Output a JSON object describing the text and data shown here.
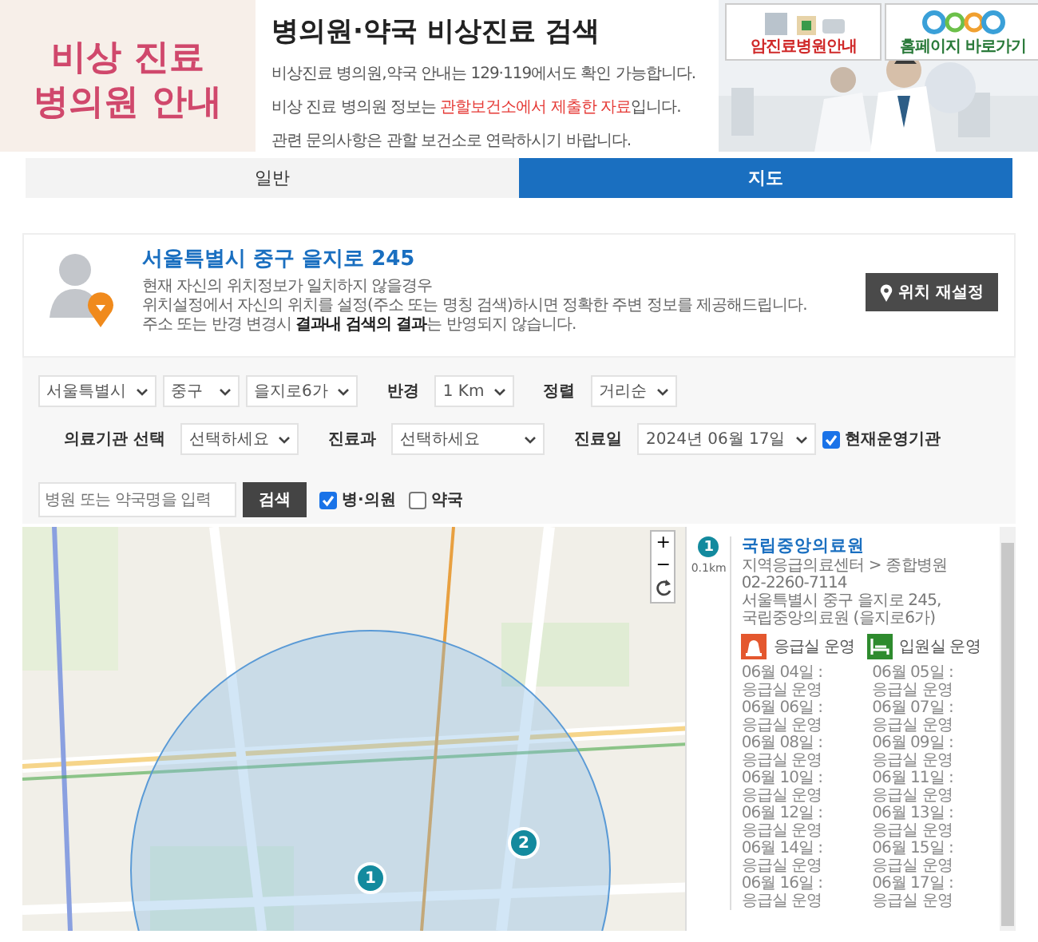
{
  "header": {
    "logo_lines": [
      "비상 진료",
      "병의원 안내"
    ],
    "title": "병의원·약국 비상진료 검색",
    "notices": [
      {
        "before": "비상진료 병의원,약국 안내는 129·119에서도 확인 가능합니다."
      },
      {
        "before": "비상 진료 병의원 정보는 ",
        "highlight": "관할보건소에서 제출한 자료",
        "after": "입니다."
      },
      {
        "before": "관련 문의사항은 관할 보건소로 연락하시기 바랍니다."
      }
    ],
    "banners": [
      {
        "label": "암진료병원안내",
        "kind": "cancer"
      },
      {
        "label": "홈페이지 바로가기",
        "kind": "home"
      }
    ]
  },
  "tabs": [
    {
      "label": "일반",
      "selected": false
    },
    {
      "label": "지도",
      "selected": true
    }
  ],
  "location": {
    "address": "서울특별시 중구 을지로 245",
    "lines": [
      "현재 자신의 위치정보가 일치하지 않을경우",
      "위치설정에서 자신의 위치를 설정(주소 또는 명칭 검색)하시면 정확한 주변 정보를 제공해드립니다.",
      "주소 또는 반경 변경시 **결과내 검색의 결과**는 반영되지 않습니다."
    ],
    "reset_button": "위치 재설정"
  },
  "filters": [
    [
      {
        "kind": "select",
        "value": "서울특별시"
      },
      {
        "kind": "select",
        "value": "중구"
      },
      {
        "kind": "select",
        "value": "을지로6가"
      },
      {
        "kind": "label",
        "text": "반경"
      },
      {
        "kind": "select",
        "value": "1 Km"
      },
      {
        "kind": "label",
        "text": "정렬"
      },
      {
        "kind": "select",
        "value": "거리순"
      }
    ],
    [
      {
        "kind": "label",
        "text": "의료기관 선택"
      },
      {
        "kind": "select",
        "value": "선택하세요"
      },
      {
        "kind": "label",
        "text": "진료과"
      },
      {
        "kind": "select",
        "value": "선택하세요"
      },
      {
        "kind": "label",
        "text": "진료일"
      },
      {
        "kind": "select",
        "value": "2024년 06월 17일"
      },
      {
        "kind": "checkbox",
        "text": "현재운영기관",
        "checked": true
      }
    ],
    [
      {
        "kind": "input",
        "placeholder": "병원 또는 약국명을 입력"
      },
      {
        "kind": "button",
        "text": "검색"
      },
      {
        "kind": "checkbox",
        "text": "병·의원",
        "checked": true
      },
      {
        "kind": "checkbox",
        "text": "약국",
        "checked": false
      }
    ]
  ],
  "map": {
    "zoom_in": "+",
    "zoom_out": "−",
    "markers": [
      {
        "label": "1"
      },
      {
        "label": "2"
      }
    ]
  },
  "results": [
    {
      "number": "1",
      "distance": "0.1km",
      "name": "국립중앙의료원",
      "category": "지역응급의료센터 > 종합병원",
      "phone": "02-2260-7114",
      "address": "서울특별시 중구 을지로 245, 국립중앙의료원 (을지로6가)",
      "facilities": [
        {
          "kind": "emergency",
          "label": "응급실 운영"
        },
        {
          "kind": "ward",
          "label": "입원실 운영"
        }
      ],
      "schedule": [
        "06월 04일 : 응급실 운영",
        "06월 05일 : 응급실 운영",
        "06월 06일 : 응급실 운영",
        "06월 07일 : 응급실 운영",
        "06월 08일 : 응급실 운영",
        "06월 09일 : 응급실 운영",
        "06월 10일 : 응급실 운영",
        "06월 11일 : 응급실 운영",
        "06월 12일 : 응급실 운영",
        "06월 13일 : 응급실 운영",
        "06월 14일 : 응급실 운영",
        "06월 15일 : 응급실 운영",
        "06월 16일 : 응급실 운영",
        "06월 17일 : 응급실 운영"
      ]
    }
  ]
}
